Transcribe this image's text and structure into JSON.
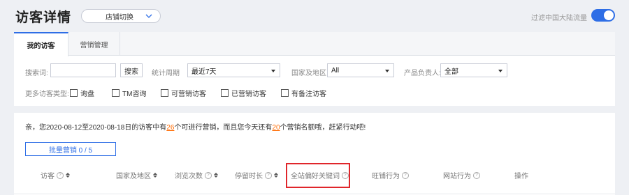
{
  "header": {
    "title": "访客详情",
    "shop_switch_label": "店铺切换",
    "filter_toggle_label": "过滤中国大陆流量",
    "filter_toggle_on": true,
    "accent_color": "#2e6ee6"
  },
  "tabs": [
    {
      "label": "我的访客",
      "active": true
    },
    {
      "label": "营销管理",
      "active": false
    }
  ],
  "filters": {
    "search_label": "搜索词:",
    "search_value": "",
    "search_button": "搜索",
    "period_label": "统计周期",
    "period_value": "最近7天",
    "country_label": "国家及地区",
    "country_value": "All",
    "owner_label": "产品负责人:",
    "owner_value": "全部",
    "more_types_label": "更多访客类型:",
    "checkboxes": [
      {
        "label": "询盘",
        "checked": false
      },
      {
        "label": "TM咨询",
        "checked": false
      },
      {
        "label": "可营销访客",
        "checked": false
      },
      {
        "label": "已营销访客",
        "checked": false
      },
      {
        "label": "有备注访客",
        "checked": false
      }
    ]
  },
  "notice": {
    "prefix": "亲，您2020-08-12至2020-08-18日的访客中有",
    "count1": "26",
    "middle": "个可进行营销，而且您今天还有",
    "count2": "20",
    "suffix": "个营销名额哦，赶紧行动吧!"
  },
  "batch_button": "批量营销  0 / 5",
  "table": {
    "columns": [
      {
        "label": "访客",
        "help": true,
        "sortable": true
      },
      {
        "label": "国家及地区",
        "help": false,
        "sortable": true
      },
      {
        "label": "浏览次数",
        "help": true,
        "sortable": true
      },
      {
        "label": "停留时长",
        "help": true,
        "sortable": true
      },
      {
        "label": "全站偏好关键词",
        "help": true,
        "sortable": false
      },
      {
        "label": "旺铺行为",
        "help": true,
        "sortable": false
      },
      {
        "label": "网站行为",
        "help": true,
        "sortable": false
      },
      {
        "label": "操作",
        "help": false,
        "sortable": false
      }
    ],
    "help_glyph": "?"
  }
}
